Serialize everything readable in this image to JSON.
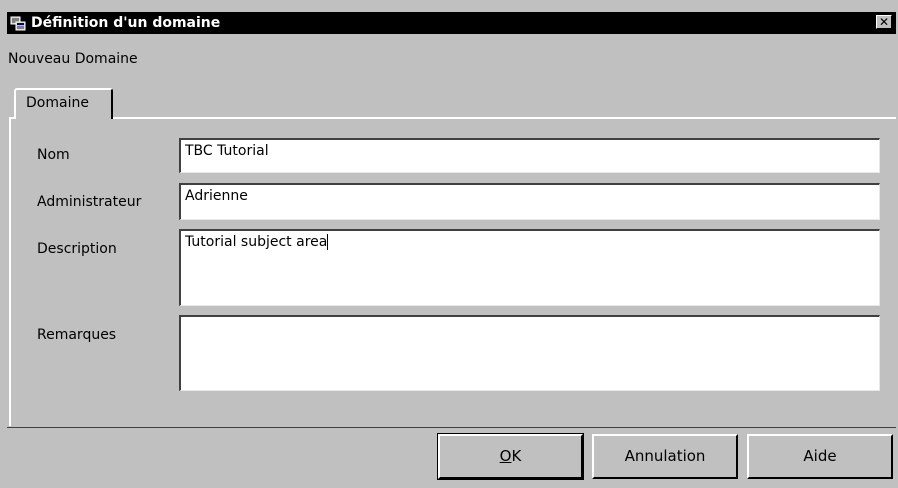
{
  "window": {
    "title": "Définition d'un domaine",
    "close_symbol": "✕",
    "app_icon": "dialog-app-icon"
  },
  "subtitle": "Nouveau Domaine",
  "tabs": [
    {
      "label": "Domaine",
      "selected": true
    }
  ],
  "form": {
    "nom": {
      "label": "Nom",
      "value": "TBC Tutorial"
    },
    "administrateur": {
      "label": "Administrateur",
      "value": "Adrienne"
    },
    "description": {
      "label": "Description",
      "value": "Tutorial subject area"
    },
    "remarques": {
      "label": "Remarques",
      "value": ""
    }
  },
  "buttons": {
    "ok": {
      "hotkey": "O",
      "rest": "K"
    },
    "annulation": "Annulation",
    "aide": "Aide"
  }
}
